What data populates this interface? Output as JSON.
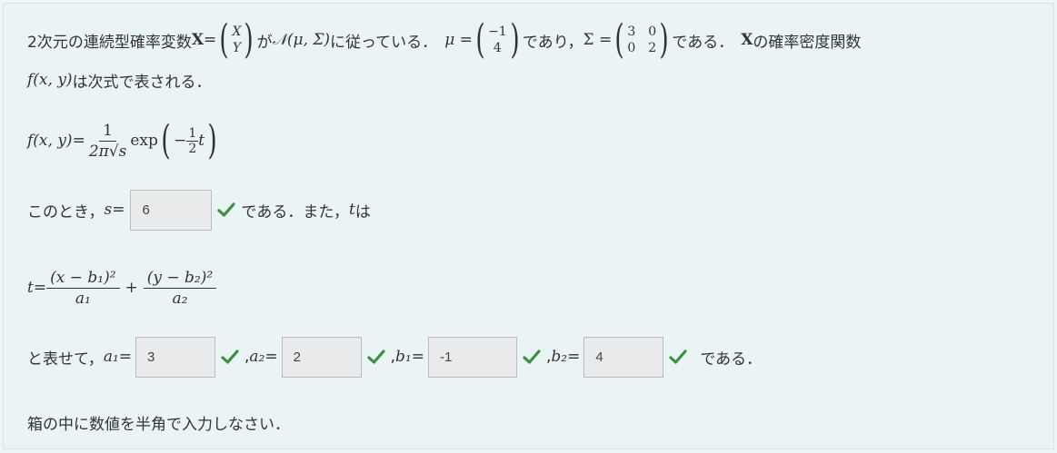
{
  "line1": {
    "prefix": "2次元の連続型確率変数 ",
    "X_bold": "X",
    "eq": " = ",
    "vec_top": "X",
    "vec_bottom": "Y",
    "ga": " が ",
    "dist": "𝒩(μ, Σ)",
    "follows": " に従っている．",
    "mu_label": "μ = ",
    "mu_top": "−1",
    "mu_bottom": "4",
    "and": " であり，",
    "sigma_label": "Σ = ",
    "sigma_matrix": [
      "3",
      "0",
      "0",
      "2"
    ],
    "is": " である．",
    "X_bold2": "X",
    "density": " の確率密度関数"
  },
  "line2": {
    "fxy": "f(x, y)",
    "rest": " は次式で表される．"
  },
  "formula": {
    "lhs": "f(x, y)",
    "eq": " = ",
    "num": "1",
    "den": "2π√s",
    "exp": "exp",
    "minus": "−",
    "half_num": "1",
    "half_den": "2",
    "t": "t"
  },
  "s_line": {
    "prefix": "このとき，",
    "s": "s",
    "eq": " = ",
    "answer": "6",
    "suffix": " である．また，",
    "t": "t",
    "wa": " は"
  },
  "t_formula": {
    "t": "t",
    "eq": " = ",
    "num1": "(x − b₁)²",
    "den1": "a₁",
    "plus": "+",
    "num2": "(y − b₂)²",
    "den2": "a₂"
  },
  "answers_line": {
    "prefix": "と表せて，",
    "a1_label": "a₁",
    "a1_value": "3",
    "a2_label": "a₂",
    "a2_value": "2",
    "b1_label": "b₁",
    "b1_value": "-1",
    "b2_label": "b₂",
    "b2_value": "4",
    "eq": " = ",
    "comma": ", ",
    "suffix": "である．"
  },
  "instruction": "箱の中に数値を半角で入力しなさい．",
  "colors": {
    "check": "#3e8e41",
    "box_bg": "#e9eaeb",
    "panel_bg": "#eaf4f5"
  },
  "icons": {
    "correct": "check-icon"
  }
}
